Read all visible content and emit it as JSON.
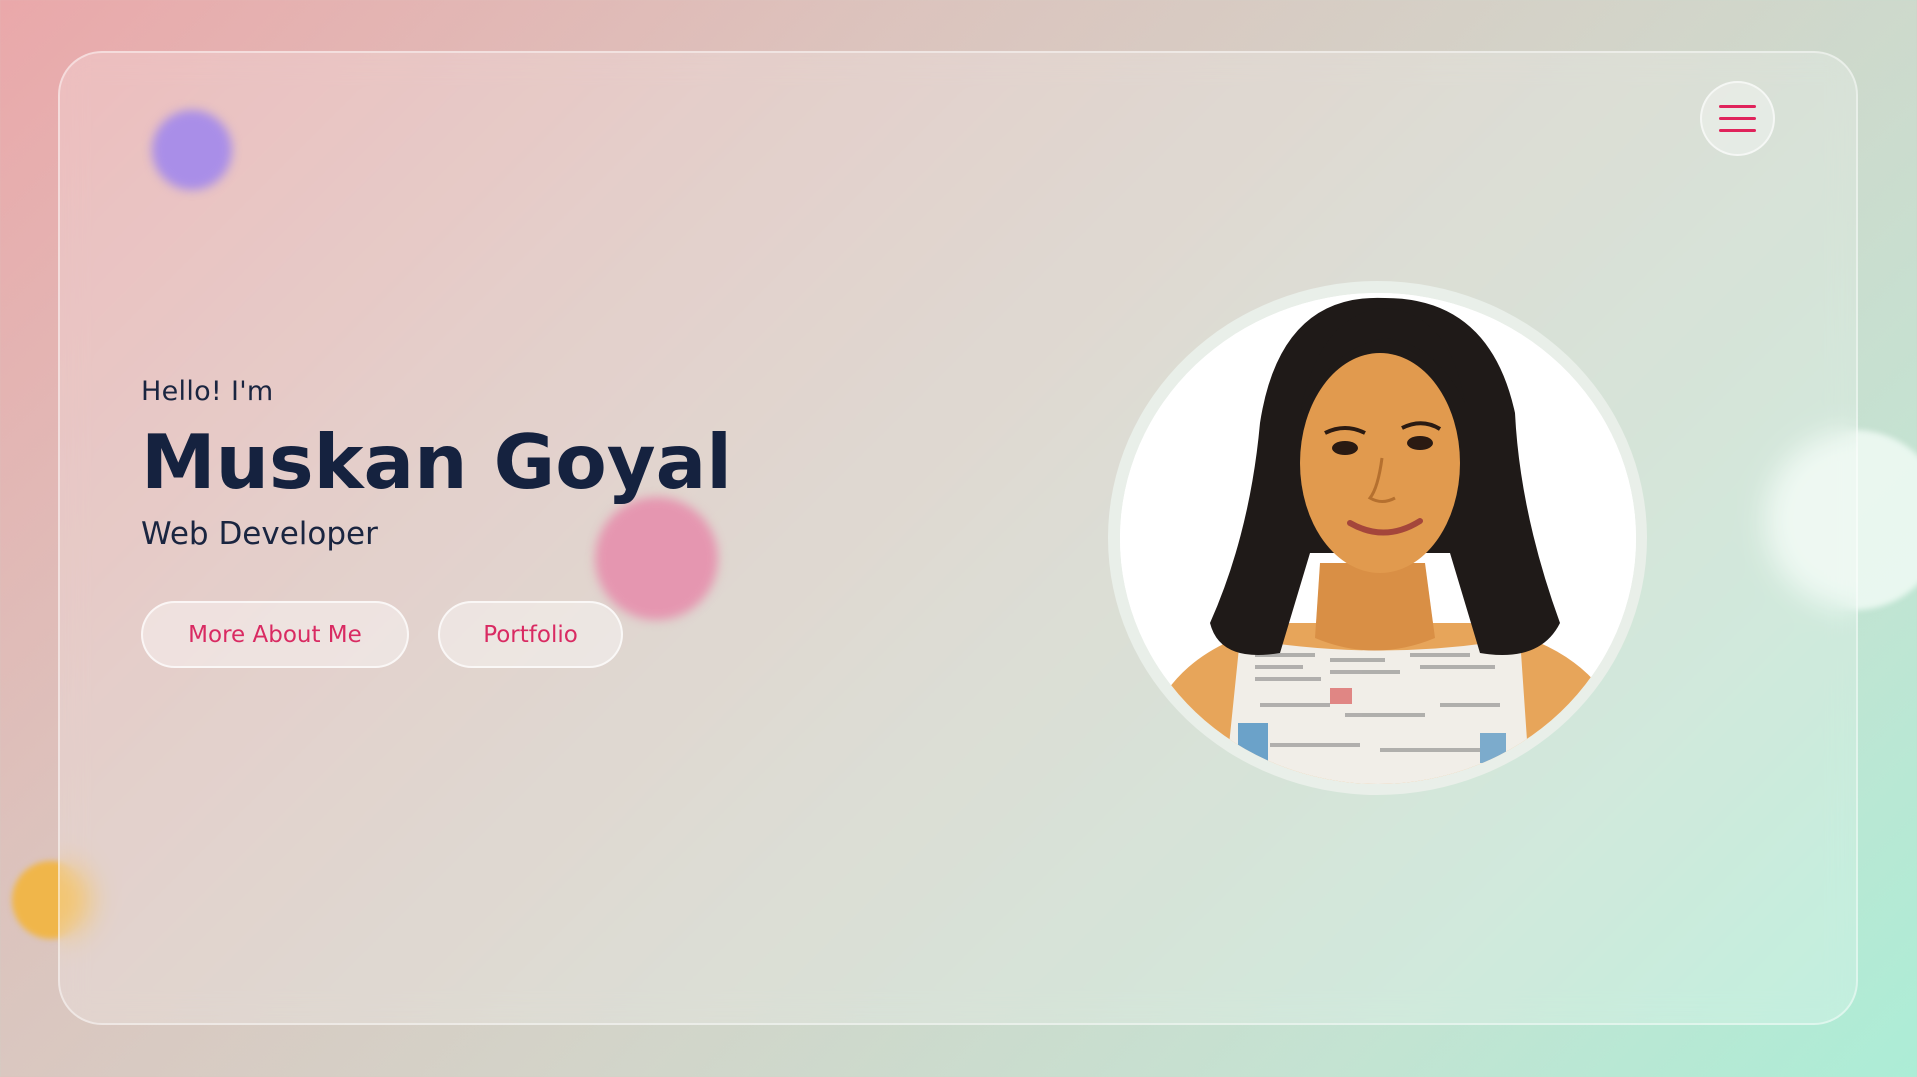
{
  "hero": {
    "greeting": "Hello! I'm",
    "name": "Muskan Goyal",
    "role": "Web Developer"
  },
  "buttons": {
    "about_label": "More About Me",
    "portfolio_label": "Portfolio"
  },
  "menu": {
    "icon": "hamburger-menu-icon"
  },
  "profile_photo": {
    "alt": "Muskan Goyal"
  },
  "colors": {
    "accent": "#d92a62",
    "heading": "#15223f",
    "blob_purple": "#a98ee8",
    "blob_pink": "#e596b0",
    "blob_orange": "#f0b64a"
  }
}
